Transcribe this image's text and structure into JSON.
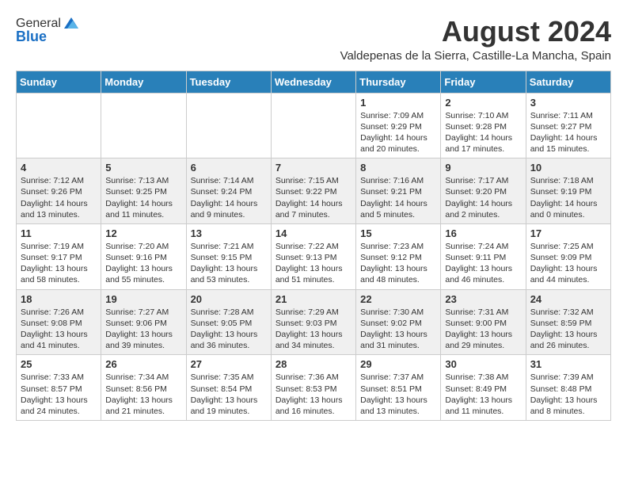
{
  "header": {
    "logo_general": "General",
    "logo_blue": "Blue",
    "month_year": "August 2024",
    "location": "Valdepenas de la Sierra, Castille-La Mancha, Spain"
  },
  "days_of_week": [
    "Sunday",
    "Monday",
    "Tuesday",
    "Wednesday",
    "Thursday",
    "Friday",
    "Saturday"
  ],
  "weeks": [
    [
      {
        "day": "",
        "info": ""
      },
      {
        "day": "",
        "info": ""
      },
      {
        "day": "",
        "info": ""
      },
      {
        "day": "",
        "info": ""
      },
      {
        "day": "1",
        "info": "Sunrise: 7:09 AM\nSunset: 9:29 PM\nDaylight: 14 hours and 20 minutes."
      },
      {
        "day": "2",
        "info": "Sunrise: 7:10 AM\nSunset: 9:28 PM\nDaylight: 14 hours and 17 minutes."
      },
      {
        "day": "3",
        "info": "Sunrise: 7:11 AM\nSunset: 9:27 PM\nDaylight: 14 hours and 15 minutes."
      }
    ],
    [
      {
        "day": "4",
        "info": "Sunrise: 7:12 AM\nSunset: 9:26 PM\nDaylight: 14 hours and 13 minutes."
      },
      {
        "day": "5",
        "info": "Sunrise: 7:13 AM\nSunset: 9:25 PM\nDaylight: 14 hours and 11 minutes."
      },
      {
        "day": "6",
        "info": "Sunrise: 7:14 AM\nSunset: 9:24 PM\nDaylight: 14 hours and 9 minutes."
      },
      {
        "day": "7",
        "info": "Sunrise: 7:15 AM\nSunset: 9:22 PM\nDaylight: 14 hours and 7 minutes."
      },
      {
        "day": "8",
        "info": "Sunrise: 7:16 AM\nSunset: 9:21 PM\nDaylight: 14 hours and 5 minutes."
      },
      {
        "day": "9",
        "info": "Sunrise: 7:17 AM\nSunset: 9:20 PM\nDaylight: 14 hours and 2 minutes."
      },
      {
        "day": "10",
        "info": "Sunrise: 7:18 AM\nSunset: 9:19 PM\nDaylight: 14 hours and 0 minutes."
      }
    ],
    [
      {
        "day": "11",
        "info": "Sunrise: 7:19 AM\nSunset: 9:17 PM\nDaylight: 13 hours and 58 minutes."
      },
      {
        "day": "12",
        "info": "Sunrise: 7:20 AM\nSunset: 9:16 PM\nDaylight: 13 hours and 55 minutes."
      },
      {
        "day": "13",
        "info": "Sunrise: 7:21 AM\nSunset: 9:15 PM\nDaylight: 13 hours and 53 minutes."
      },
      {
        "day": "14",
        "info": "Sunrise: 7:22 AM\nSunset: 9:13 PM\nDaylight: 13 hours and 51 minutes."
      },
      {
        "day": "15",
        "info": "Sunrise: 7:23 AM\nSunset: 9:12 PM\nDaylight: 13 hours and 48 minutes."
      },
      {
        "day": "16",
        "info": "Sunrise: 7:24 AM\nSunset: 9:11 PM\nDaylight: 13 hours and 46 minutes."
      },
      {
        "day": "17",
        "info": "Sunrise: 7:25 AM\nSunset: 9:09 PM\nDaylight: 13 hours and 44 minutes."
      }
    ],
    [
      {
        "day": "18",
        "info": "Sunrise: 7:26 AM\nSunset: 9:08 PM\nDaylight: 13 hours and 41 minutes."
      },
      {
        "day": "19",
        "info": "Sunrise: 7:27 AM\nSunset: 9:06 PM\nDaylight: 13 hours and 39 minutes."
      },
      {
        "day": "20",
        "info": "Sunrise: 7:28 AM\nSunset: 9:05 PM\nDaylight: 13 hours and 36 minutes."
      },
      {
        "day": "21",
        "info": "Sunrise: 7:29 AM\nSunset: 9:03 PM\nDaylight: 13 hours and 34 minutes."
      },
      {
        "day": "22",
        "info": "Sunrise: 7:30 AM\nSunset: 9:02 PM\nDaylight: 13 hours and 31 minutes."
      },
      {
        "day": "23",
        "info": "Sunrise: 7:31 AM\nSunset: 9:00 PM\nDaylight: 13 hours and 29 minutes."
      },
      {
        "day": "24",
        "info": "Sunrise: 7:32 AM\nSunset: 8:59 PM\nDaylight: 13 hours and 26 minutes."
      }
    ],
    [
      {
        "day": "25",
        "info": "Sunrise: 7:33 AM\nSunset: 8:57 PM\nDaylight: 13 hours and 24 minutes."
      },
      {
        "day": "26",
        "info": "Sunrise: 7:34 AM\nSunset: 8:56 PM\nDaylight: 13 hours and 21 minutes."
      },
      {
        "day": "27",
        "info": "Sunrise: 7:35 AM\nSunset: 8:54 PM\nDaylight: 13 hours and 19 minutes."
      },
      {
        "day": "28",
        "info": "Sunrise: 7:36 AM\nSunset: 8:53 PM\nDaylight: 13 hours and 16 minutes."
      },
      {
        "day": "29",
        "info": "Sunrise: 7:37 AM\nSunset: 8:51 PM\nDaylight: 13 hours and 13 minutes."
      },
      {
        "day": "30",
        "info": "Sunrise: 7:38 AM\nSunset: 8:49 PM\nDaylight: 13 hours and 11 minutes."
      },
      {
        "day": "31",
        "info": "Sunrise: 7:39 AM\nSunset: 8:48 PM\nDaylight: 13 hours and 8 minutes."
      }
    ]
  ]
}
